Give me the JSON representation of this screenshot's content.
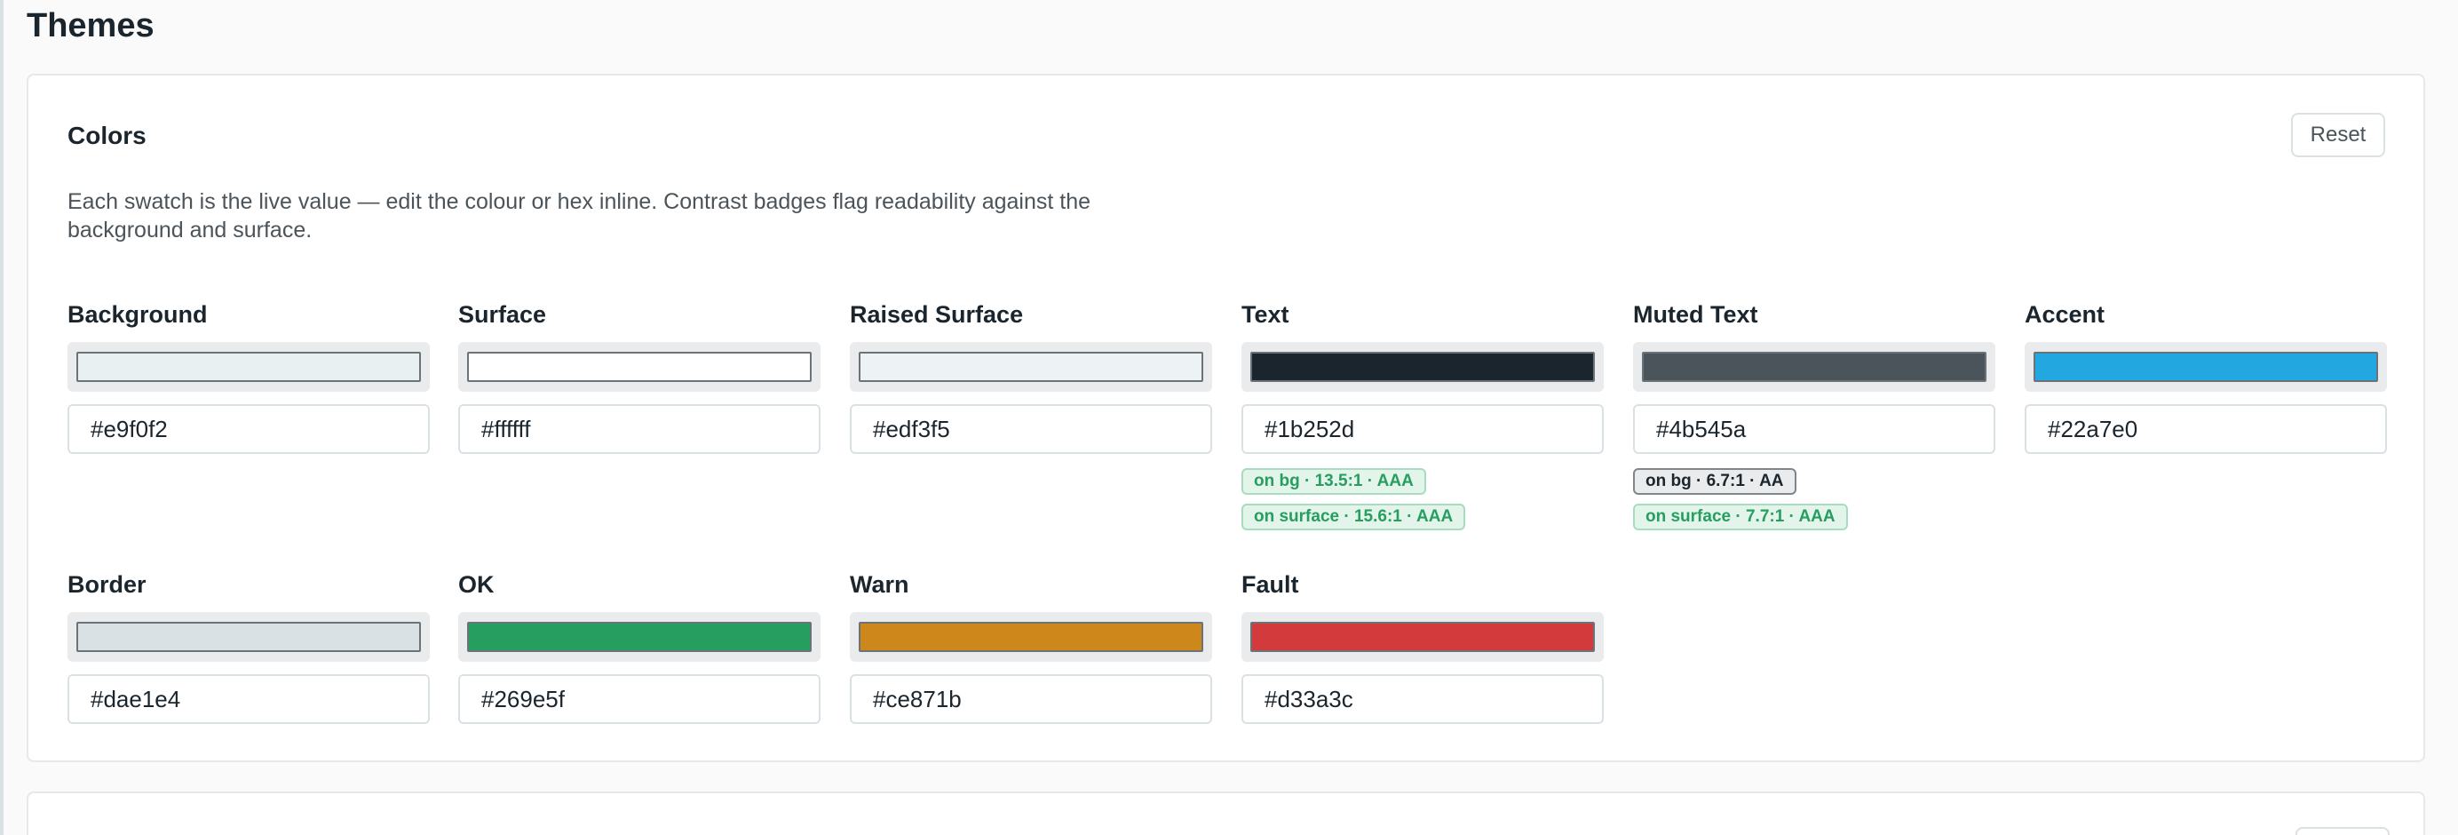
{
  "page": {
    "title": "Themes"
  },
  "colors_card": {
    "title": "Colors",
    "reset_label": "Reset",
    "description": "Each swatch is the live value — edit the colour or hex inline. Contrast badges flag readability against the background and surface."
  },
  "colors": [
    {
      "label": "Background",
      "hex": "#e9f0f2",
      "badges": []
    },
    {
      "label": "Surface",
      "hex": "#ffffff",
      "badges": []
    },
    {
      "label": "Raised Surface",
      "hex": "#edf3f5",
      "badges": []
    },
    {
      "label": "Text",
      "hex": "#1b252d",
      "badges": [
        {
          "text": "on bg · 13.5:1 · AAA",
          "level": "good"
        },
        {
          "text": "on surface · 15.6:1 · AAA",
          "level": "good"
        }
      ]
    },
    {
      "label": "Muted Text",
      "hex": "#4b545a",
      "badges": [
        {
          "text": "on bg · 6.7:1 · AA",
          "level": "neutral"
        },
        {
          "text": "on surface · 7.7:1 · AAA",
          "level": "good"
        }
      ]
    },
    {
      "label": "Accent",
      "hex": "#22a7e0",
      "badges": []
    },
    {
      "label": "Border",
      "hex": "#dae1e4",
      "badges": []
    },
    {
      "label": "OK",
      "hex": "#269e5f",
      "badges": []
    },
    {
      "label": "Warn",
      "hex": "#ce871b",
      "badges": []
    },
    {
      "label": "Fault",
      "hex": "#d33a3c",
      "badges": []
    }
  ]
}
